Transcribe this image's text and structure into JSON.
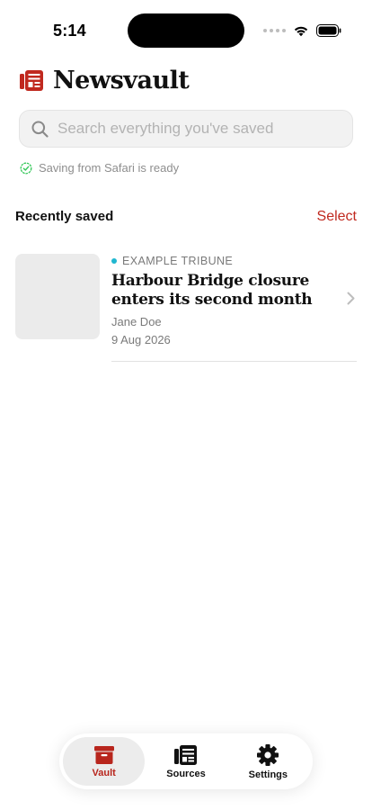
{
  "status_bar": {
    "time": "5:14"
  },
  "header": {
    "title": "Newsvault"
  },
  "search": {
    "placeholder": "Search everything you've saved",
    "value": ""
  },
  "safari_status": {
    "text": "Saving from Safari is ready"
  },
  "recent": {
    "title": "Recently saved",
    "select_label": "Select",
    "items": [
      {
        "source": "EXAMPLE TRIBUNE",
        "headline": "Harbour Bridge closure enters its second month",
        "author": "Jane Doe",
        "date": "9 Aug 2026"
      }
    ]
  },
  "tabbar": {
    "tabs": [
      {
        "label": "Vault",
        "icon": "archive-box-icon",
        "active": true
      },
      {
        "label": "Sources",
        "icon": "newspaper-icon",
        "active": false
      },
      {
        "label": "Settings",
        "icon": "gear-icon",
        "active": false
      }
    ]
  },
  "colors": {
    "accent": "#c0291f",
    "source_dot": "#20b7d0",
    "success": "#34c759"
  }
}
